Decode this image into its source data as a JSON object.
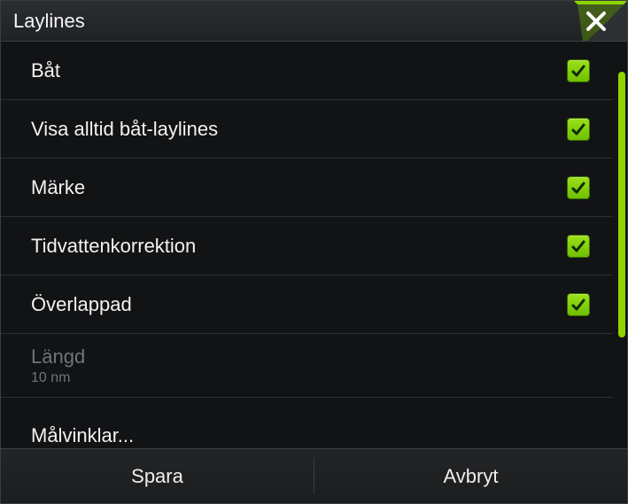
{
  "title": "Laylines",
  "accent": "#8fd400",
  "rows": [
    {
      "label": "Båt",
      "checked": true
    },
    {
      "label": "Visa alltid båt-laylines",
      "checked": true
    },
    {
      "label": "Märke",
      "checked": true
    },
    {
      "label": "Tidvattenkorrektion",
      "checked": true
    },
    {
      "label": "Överlappad",
      "checked": true
    }
  ],
  "length": {
    "label": "Längd",
    "value": "10 nm"
  },
  "targets_label": "Målvinklar...",
  "footer": {
    "save": "Spara",
    "cancel": "Avbryt"
  }
}
